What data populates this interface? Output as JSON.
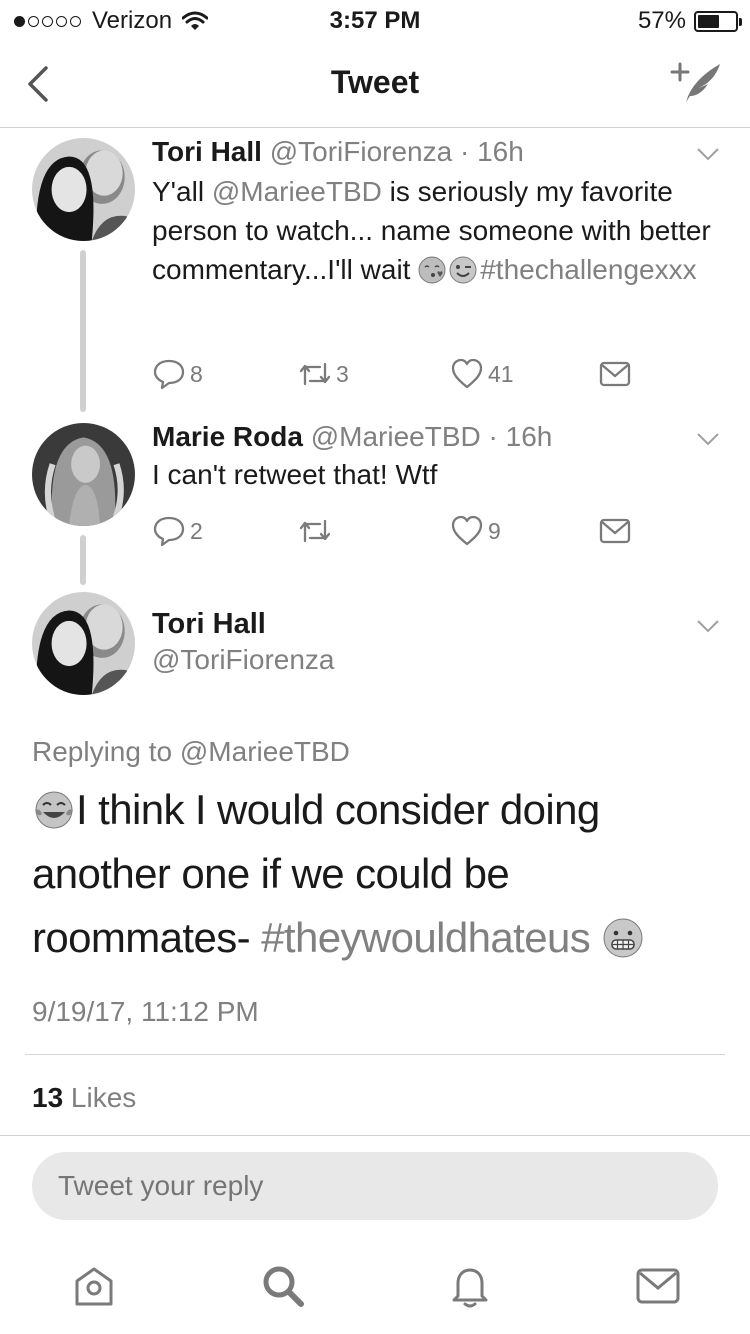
{
  "status_bar": {
    "carrier": "Verizon",
    "time": "3:57 PM",
    "battery": "57%",
    "battery_level": 0.57,
    "signal_bars": 1,
    "signal_total": 5
  },
  "nav": {
    "title": "Tweet",
    "back_icon": "chevron-left-icon",
    "compose_icon": "compose-quill-icon"
  },
  "thread": [
    {
      "name": "Tori Hall",
      "handle": "@ToriFiorenza",
      "time": "· 16h",
      "text_1": "Y'all ",
      "mention": "@MarieeTBD",
      "text_2": " is seriously my favorite person to watch... name someone with better commentary...I'll wait ",
      "emojis": [
        "kissing-face-emoji",
        "winking-face-emoji"
      ],
      "hashtag": "#thechallengexxx",
      "replies": "8",
      "retweets": "3",
      "likes": "41"
    },
    {
      "name": "Marie Roda",
      "handle": "@MarieeTBD",
      "time": "· 16h",
      "text": "I can't retweet that! Wtf",
      "replies": "2",
      "retweets": "",
      "likes": "9"
    }
  ],
  "main_tweet": {
    "name": "Tori Hall",
    "handle": "@ToriFiorenza",
    "replying_prefix": "Replying to ",
    "replying_to": "@MarieeTBD",
    "text": "I think I would consider doing another one if we could be roommates- ",
    "hashtag": "#theywouldhateus",
    "emojis": [
      "tears-of-joy-emoji",
      "grimacing-face-emoji"
    ],
    "date": "9/19/17, 11:12 PM",
    "likes_count": "13",
    "likes_label": " Likes"
  },
  "reply": {
    "placeholder": "Tweet your reply"
  },
  "tab_bar": {
    "items": [
      "home-icon",
      "search-icon",
      "notifications-icon",
      "messages-icon"
    ]
  }
}
